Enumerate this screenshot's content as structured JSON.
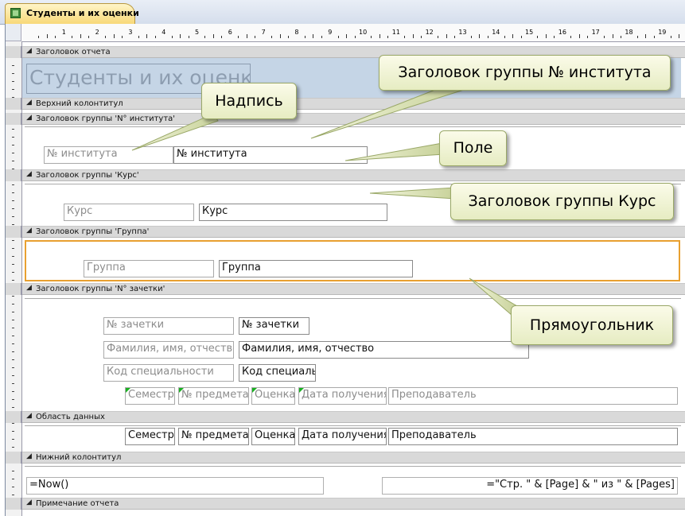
{
  "window": {
    "tab_title": "Студенты и их оценки"
  },
  "ruler": {
    "marks": [
      "1",
      "2",
      "3",
      "4",
      "5",
      "6",
      "7",
      "8",
      "9",
      "10",
      "11",
      "12",
      "13",
      "14",
      "15",
      "16",
      "17",
      "18",
      "19"
    ]
  },
  "bands": {
    "report_header": "Заголовок отчета",
    "page_header": "Верхний колонтитул",
    "group_institute": "Заголовок группы 'N° института'",
    "group_course": "Заголовок группы 'Курс'",
    "group_group": "Заголовок группы 'Группа'",
    "group_record": "Заголовок группы 'N° зачетки'",
    "detail": "Область данных",
    "page_footer": "Нижний колонтитул",
    "report_footer": "Примечание отчета"
  },
  "report_title": "Студенты и их оценки",
  "institute": {
    "label": "№ института",
    "field": "№ института"
  },
  "course": {
    "label": "Курс",
    "field": "Курс"
  },
  "group": {
    "label": "Группа",
    "field": "Группа"
  },
  "record": {
    "label_record": "№ зачетки",
    "field_record": "№ зачетки",
    "label_name": "Фамилия, имя, отчество",
    "field_name": "Фамилия, имя, отчество",
    "label_spec": "Код специальности",
    "field_spec": "Код специаль",
    "col_semester": "Семестр",
    "col_subject": "№ предмета",
    "col_grade": "Оценка",
    "col_date": "Дата получения",
    "col_teacher": "Преподаватель"
  },
  "detail": {
    "semester": "Семестр",
    "subject": "№ предмета",
    "grade": "Оценка",
    "date": "Дата получения",
    "teacher": "Преподаватель"
  },
  "footer": {
    "now": "=Now()",
    "pages": "=\"Стр. \" & [Page] & \" из \" & [Pages]"
  },
  "callouts": {
    "group_header": "Заголовок группы № института",
    "label": "Надпись",
    "field": "Поле",
    "group_course": "Заголовок группы Курс",
    "rectangle": "Прямоугольник"
  },
  "colors": {
    "band": "#d9d9d9",
    "report_header_bg": "#c5d5e6",
    "selection": "#e8a030",
    "field_tag": "#18b020",
    "tab_active": "#f8d878"
  }
}
